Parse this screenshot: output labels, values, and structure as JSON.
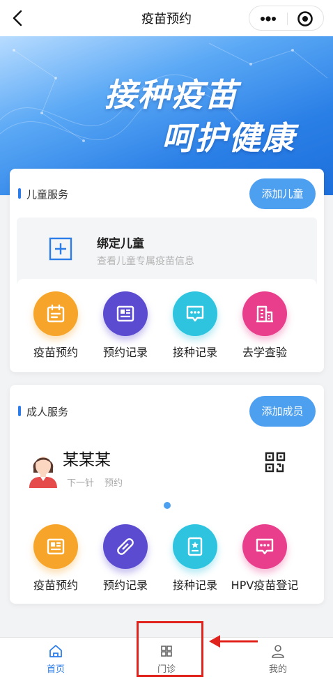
{
  "navbar": {
    "title": "疫苗预约"
  },
  "banner": {
    "slogan_line1": "接种疫苗",
    "slogan_line2": "呵护健康"
  },
  "child_service": {
    "title": "儿童服务",
    "add_button": "添加儿童",
    "bind": {
      "title": "绑定儿童",
      "subtitle": "查看儿童专属疫苗信息"
    },
    "items": [
      {
        "label": "疫苗预约",
        "icon": "calendar-icon",
        "color": "#f7a52a"
      },
      {
        "label": "预约记录",
        "icon": "record-icon",
        "color": "#5b4bd0"
      },
      {
        "label": "接种记录",
        "icon": "chat-icon",
        "color": "#2ec4e0"
      },
      {
        "label": "去学查验",
        "icon": "building-icon",
        "color": "#e83e8c"
      }
    ]
  },
  "adult_service": {
    "title": "成人服务",
    "add_button": "添加成员",
    "member": {
      "name": "某某某",
      "next_label": "下一针",
      "next_value": "预约"
    },
    "items": [
      {
        "label": "疫苗预约",
        "icon": "document-icon",
        "color": "#f7a52a"
      },
      {
        "label": "预约记录",
        "icon": "pill-icon",
        "color": "#5b4bd0"
      },
      {
        "label": "接种记录",
        "icon": "certificate-icon",
        "color": "#2ec4e0"
      },
      {
        "label": "HPV疫苗登记",
        "icon": "chat-icon",
        "color": "#e83e8c"
      }
    ]
  },
  "tabbar": {
    "tabs": [
      {
        "label": "首页",
        "icon": "home-icon",
        "active": true
      },
      {
        "label": "门诊",
        "icon": "grid-icon",
        "active": false
      },
      {
        "label": "我的",
        "icon": "user-icon",
        "active": false
      }
    ]
  },
  "colors": {
    "primary": "#2b7de9",
    "button": "#4da0f0",
    "annotation": "#e0231c"
  }
}
